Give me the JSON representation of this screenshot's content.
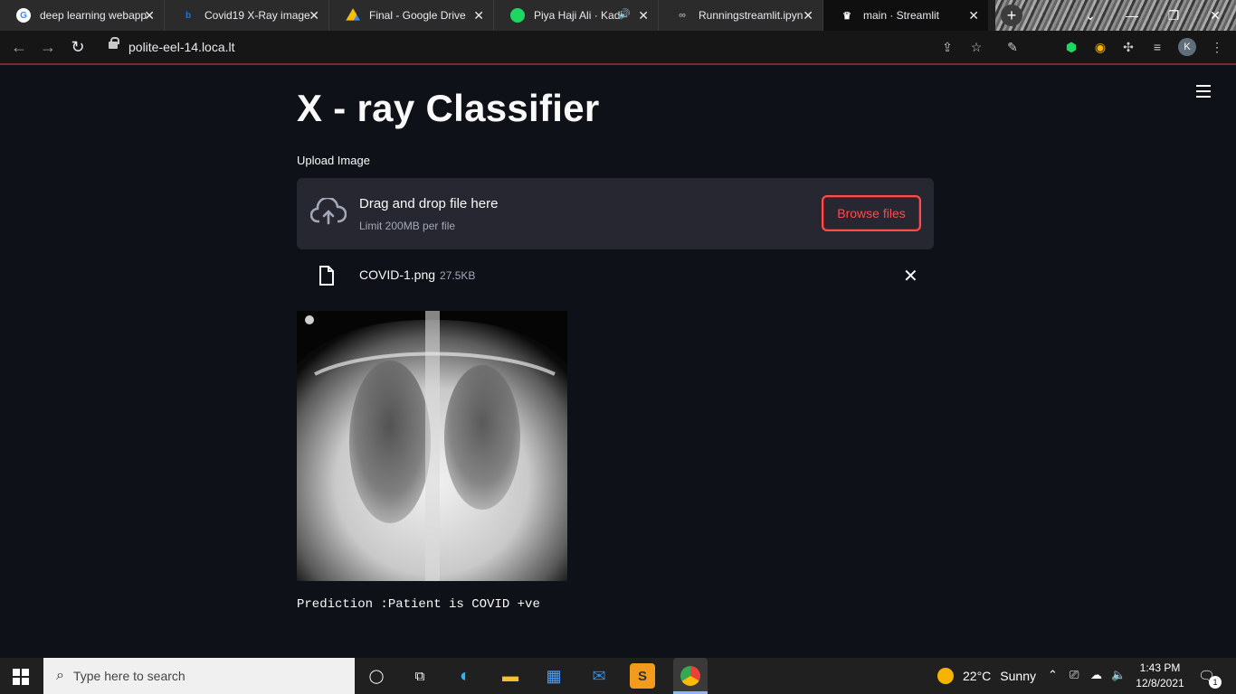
{
  "browser": {
    "tabs": [
      {
        "title": "deep learning webapp",
        "favicon": "google-icon",
        "color": "#4285f4"
      },
      {
        "title": "Covid19 X-Ray image",
        "favicon": "bing-icon",
        "color": "#1a73e8"
      },
      {
        "title": "Final - Google Drive",
        "favicon": "drive-icon",
        "color": "#fbbc04"
      },
      {
        "title": "Piya Haji Ali · Kad",
        "favicon": "spotify-icon",
        "color": "#1ed760"
      },
      {
        "title": "Runningstreamlit.ipyn",
        "favicon": "colab-icon",
        "color": "#9aa0a6"
      },
      {
        "title": "main · Streamlit",
        "favicon": "streamlit-icon",
        "color": "#ffffff"
      }
    ],
    "url": "polite-eel-14.loca.lt",
    "profile_initial": "K"
  },
  "app": {
    "title": "X - ray Classifier",
    "upload_label": "Upload Image",
    "dropzone_title": "Drag and drop file here",
    "dropzone_limit": "Limit 200MB per file",
    "browse_label": "Browse files",
    "file": {
      "name": "COVID-1.png",
      "size": "27.5KB"
    },
    "prediction": "Prediction :Patient is COVID +ve",
    "accent": "#ff4b4b"
  },
  "taskbar": {
    "search_placeholder": "Type here to search",
    "weather": {
      "temp": "22°C",
      "condition": "Sunny"
    },
    "time": "1:43 PM",
    "date": "12/8/2021",
    "notification_count": "1"
  }
}
